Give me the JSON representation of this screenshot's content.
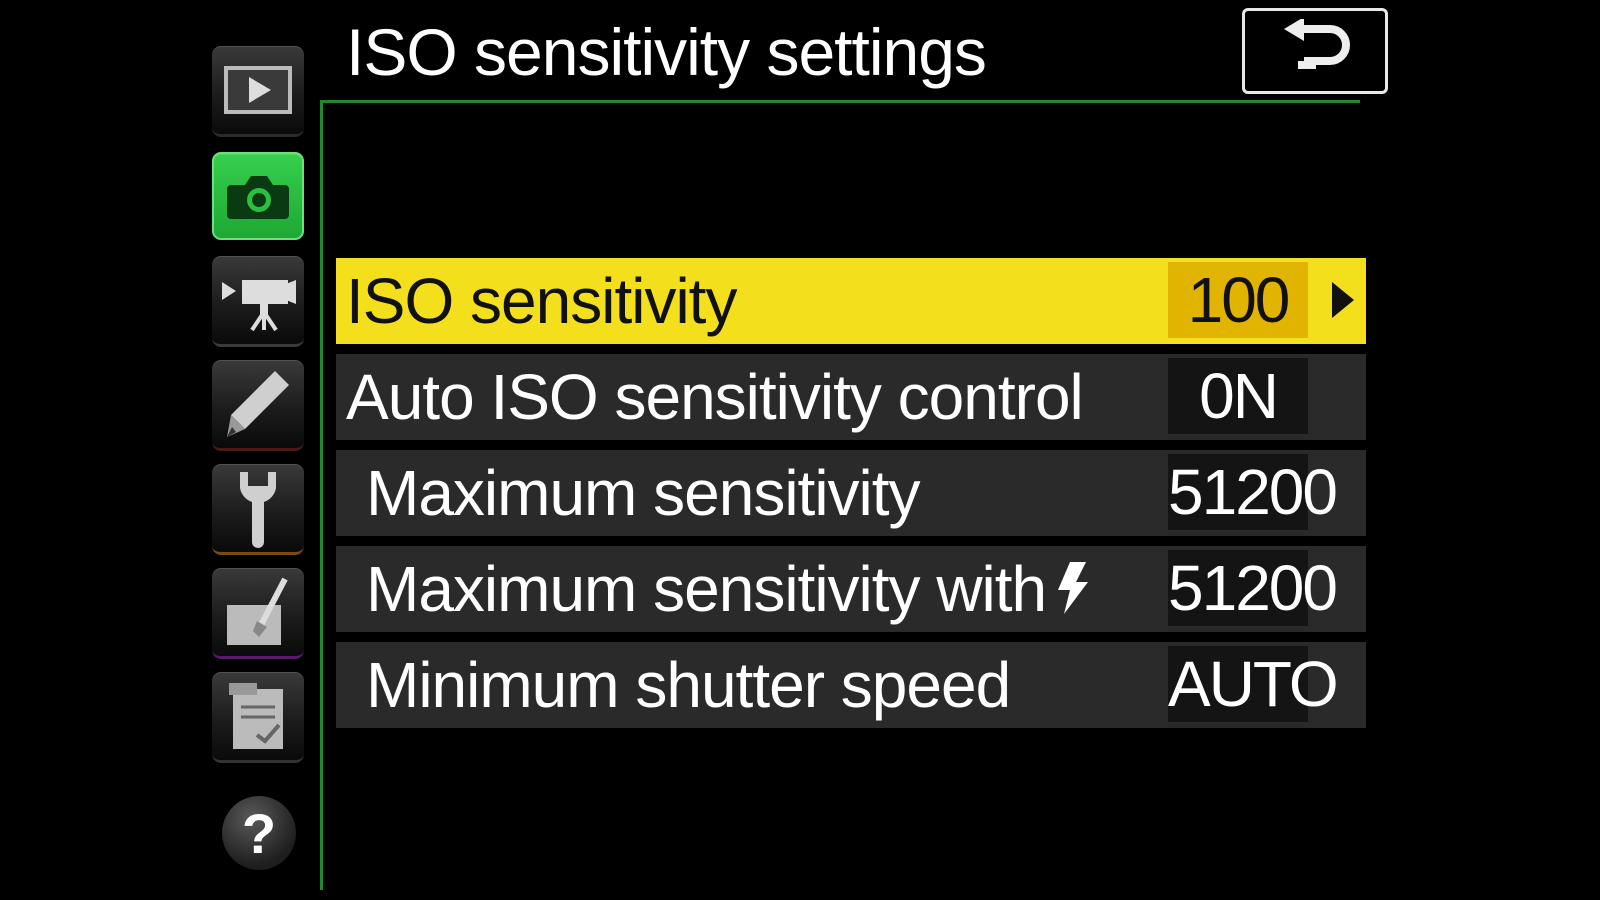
{
  "header": {
    "title": "ISO sensitivity settings",
    "back_icon": "return-arrow-icon"
  },
  "sidebar": {
    "tabs": [
      {
        "name": "playback-menu",
        "icon": "play-icon",
        "active": false
      },
      {
        "name": "photo-shooting-menu",
        "icon": "camera-icon",
        "active": true
      },
      {
        "name": "movie-shooting-menu",
        "icon": "movie-camera-icon",
        "active": false
      },
      {
        "name": "custom-settings-menu",
        "icon": "pencil-icon",
        "active": false
      },
      {
        "name": "setup-menu",
        "icon": "wrench-icon",
        "active": false
      },
      {
        "name": "retouch-menu",
        "icon": "retouch-brush-icon",
        "active": false
      },
      {
        "name": "recent-settings-menu",
        "icon": "clipboard-check-icon",
        "active": false
      }
    ],
    "help_label": "?"
  },
  "menu": {
    "items": [
      {
        "label": "ISO sensitivity",
        "value": "100",
        "selected": true
      },
      {
        "label": "Auto ISO sensitivity control",
        "value": "0N",
        "selected": false
      },
      {
        "label": "Maximum sensitivity",
        "value": "51200",
        "selected": false
      },
      {
        "label": "Maximum sensitivity with",
        "value": "51200",
        "selected": false,
        "icon": "flash-icon"
      },
      {
        "label": "Minimum shutter speed",
        "value": "AUTO",
        "selected": false
      }
    ]
  },
  "colors": {
    "highlight": "#f3df1c",
    "highlight_value": "#e0b400",
    "active_tab": "#2cc040",
    "frame": "#1f8a2c"
  }
}
